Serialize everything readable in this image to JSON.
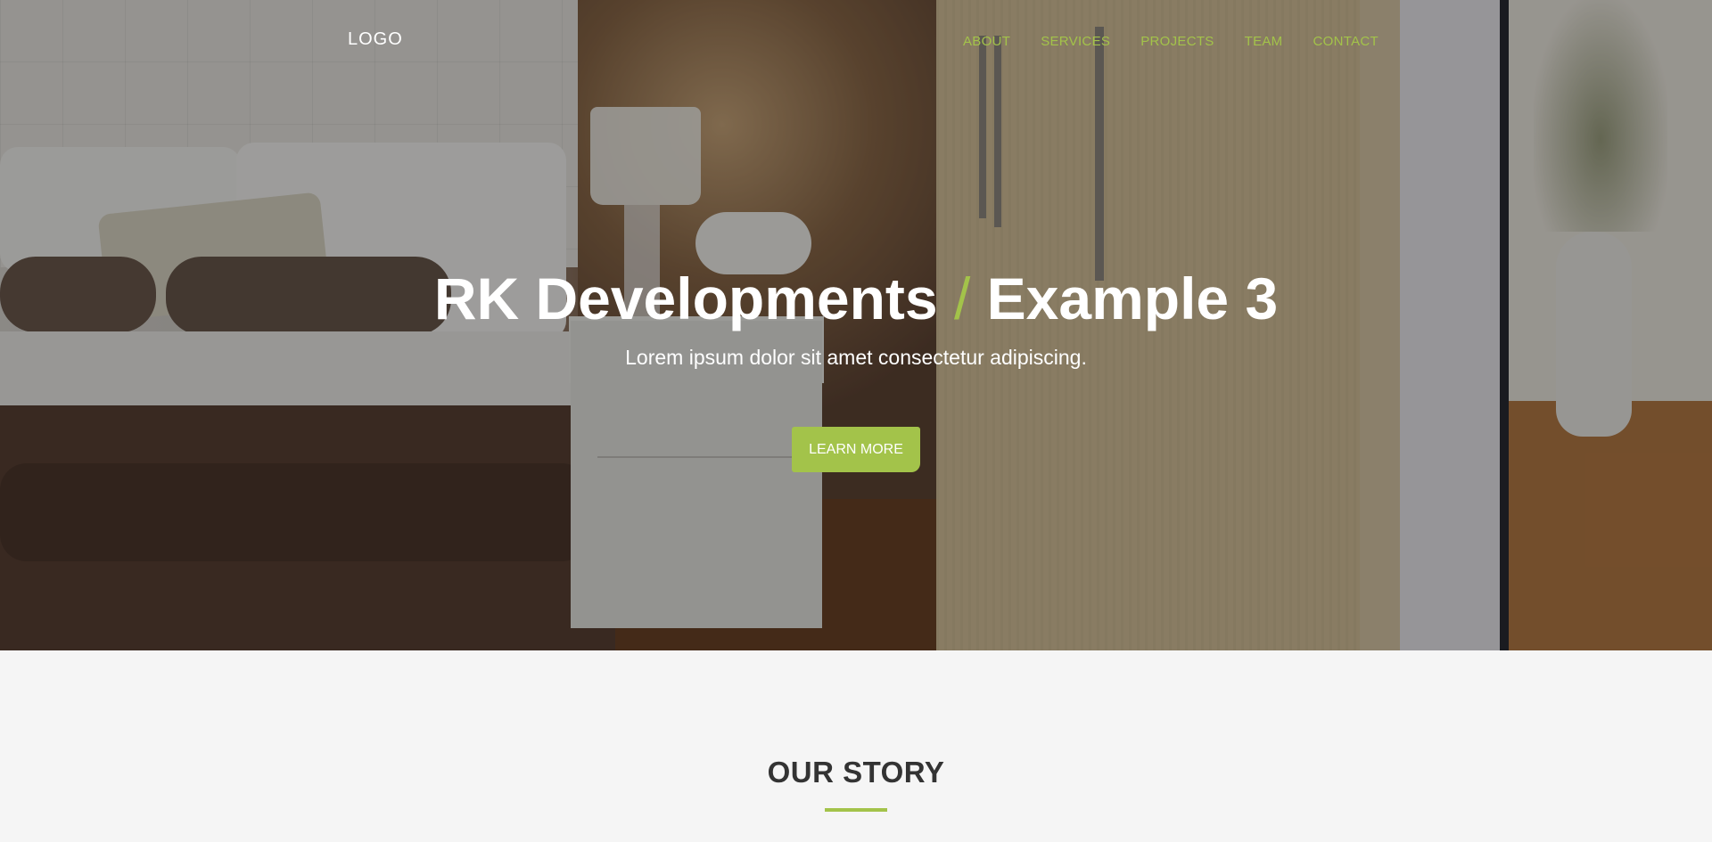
{
  "header": {
    "logo": "LOGO",
    "nav": [
      {
        "label": "ABOUT"
      },
      {
        "label": "SERVICES"
      },
      {
        "label": "PROJECTS"
      },
      {
        "label": "TEAM"
      },
      {
        "label": "CONTACT"
      }
    ]
  },
  "hero": {
    "title_strong": "RK Developments",
    "title_separator": "/",
    "title_light": "Example 3",
    "subtitle": "Lorem ipsum dolor sit amet consectetur adipiscing.",
    "cta_label": "LEARN MORE"
  },
  "story": {
    "heading": "OUR STORY"
  },
  "colors": {
    "accent": "#a3c34a",
    "heading": "#333333",
    "section_bg": "#f5f5f5"
  }
}
